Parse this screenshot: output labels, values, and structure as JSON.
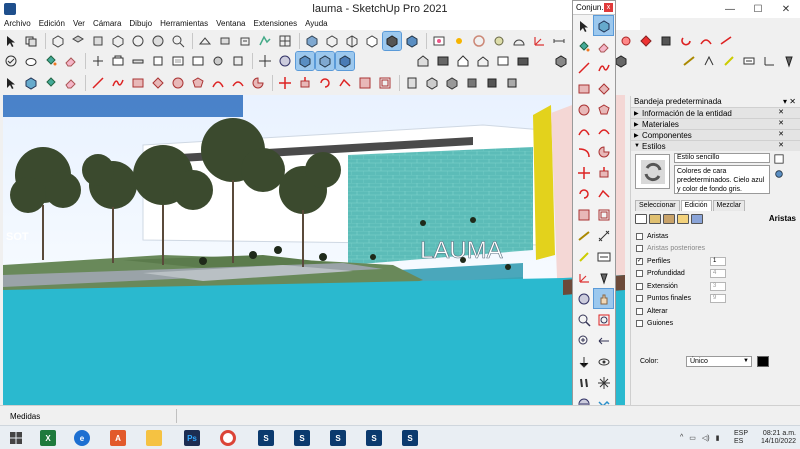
{
  "window": {
    "title": "lauma - SketchUp Pro 2021",
    "minimize": "—",
    "maximize": "☐",
    "close": "✕"
  },
  "menu": [
    "Archivo",
    "Edición",
    "Ver",
    "Cámara",
    "Dibujo",
    "Herramientas",
    "Ventana",
    "Extensiones",
    "Ayuda"
  ],
  "floating_toolbar": {
    "title": "Conjun...",
    "close": "x"
  },
  "tray": {
    "title": "Bandeja predeterminada",
    "pin": "📌",
    "panels": [
      {
        "label": "Información de la entidad",
        "state": "collapsed"
      },
      {
        "label": "Materiales",
        "state": "collapsed"
      },
      {
        "label": "Componentes",
        "state": "collapsed"
      },
      {
        "label": "Estilos",
        "state": "expanded"
      }
    ],
    "style_name": "Estilo sencillo",
    "style_description": "Colores de cara predeterminados. Cielo azul y color de fondo gris.",
    "tabs": [
      "Seleccionar",
      "Edición",
      "Mezclar"
    ],
    "active_tab": "Edición",
    "section_label": "Aristas",
    "options": [
      {
        "label": "Aristas",
        "checked": false,
        "disabled": false,
        "value": null
      },
      {
        "label": "Aristas posteriores",
        "checked": false,
        "disabled": true,
        "value": null
      },
      {
        "label": "Perfiles",
        "checked": true,
        "disabled": false,
        "value": "1"
      },
      {
        "label": "Profundidad",
        "checked": false,
        "disabled": false,
        "value": "4"
      },
      {
        "label": "Extensión",
        "checked": false,
        "disabled": false,
        "value": "3"
      },
      {
        "label": "Puntos finales",
        "checked": false,
        "disabled": false,
        "value": "9"
      },
      {
        "label": "Alterar",
        "checked": false,
        "disabled": false,
        "value": null
      },
      {
        "label": "Guiones",
        "checked": false,
        "disabled": false,
        "value": null
      }
    ],
    "color_label": "Color:",
    "color_value": "Único",
    "color_swatch": "#000000"
  },
  "scene": {
    "sign_text": "LAUMA",
    "left_sign_text": "SOT"
  },
  "status": {
    "label": "Medidas"
  },
  "taskbar": {
    "language": [
      "ESP",
      "ES"
    ],
    "time": "08:21 a.m.",
    "date": "14/10/2022"
  },
  "colors": {
    "water": "#2ab9cf",
    "sky": "#f3f6fb",
    "accent_selected": "#9cc8ee"
  }
}
